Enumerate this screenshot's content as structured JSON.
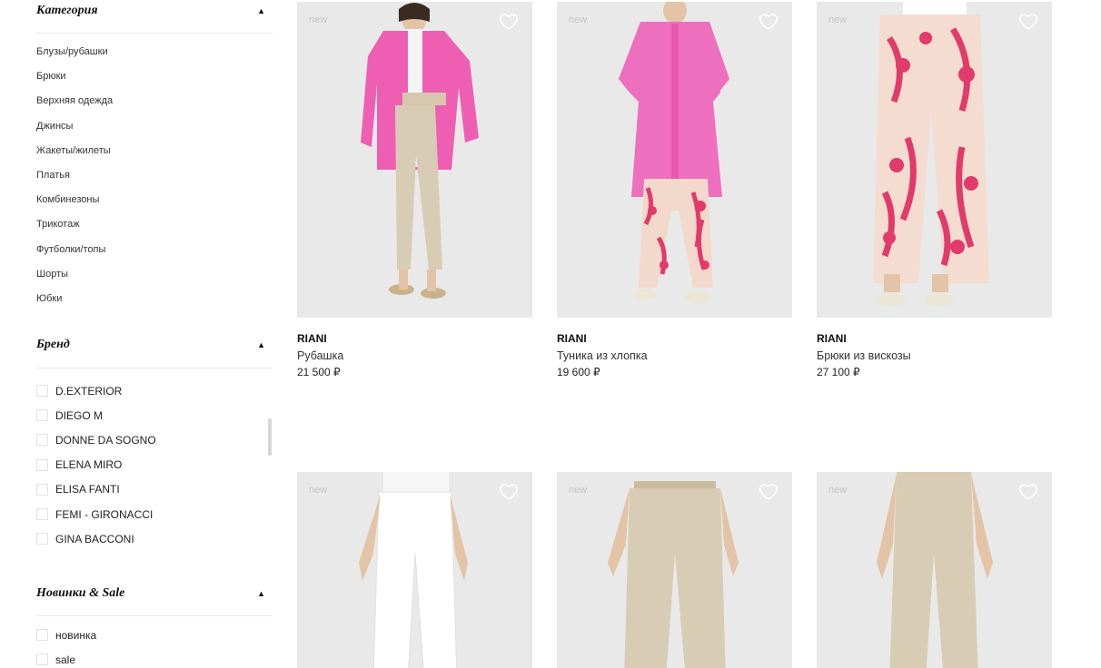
{
  "sidebar": {
    "category": {
      "title": "Категория",
      "items": [
        "Блузы/рубашки",
        "Брюки",
        "Верхняя одежда",
        "Джинсы",
        "Жакеты/жилеты",
        "Платья",
        "Комбинезоны",
        "Трикотаж",
        "Футболки/топы",
        "Шорты",
        "Юбки"
      ]
    },
    "brand": {
      "title": "Бренд",
      "items": [
        "D.EXTERIOR",
        "DIEGO M",
        "DONNE DA SOGNO",
        "ELENA MIRO",
        "ELISA FANTI",
        "FEMI - GIRONACCI",
        "GINA BACCONI"
      ]
    },
    "new_sale": {
      "title": "Новинки & Sale",
      "items": [
        "новинка",
        "sale"
      ]
    }
  },
  "products": [
    {
      "brand": "RIANI",
      "name": "Рубашка",
      "price": "21 500 ₽",
      "badge": "new"
    },
    {
      "brand": "RIANI",
      "name": "Туника из хлопка",
      "price": "19 600 ₽",
      "badge": "new"
    },
    {
      "brand": "RIANI",
      "name": "Брюки из вискозы",
      "price": "27 100 ₽",
      "badge": "new"
    },
    {
      "badge": "new"
    },
    {
      "badge": "new"
    },
    {
      "badge": "new"
    }
  ],
  "icons": {
    "collapse": "caret-up-icon",
    "favorite": "heart-outline-icon"
  },
  "colors": {
    "photo_bg": "#e9e9e9",
    "pink": "#ee5fb3",
    "beige": "#d9ccb5",
    "floral": "#e23a6a"
  }
}
